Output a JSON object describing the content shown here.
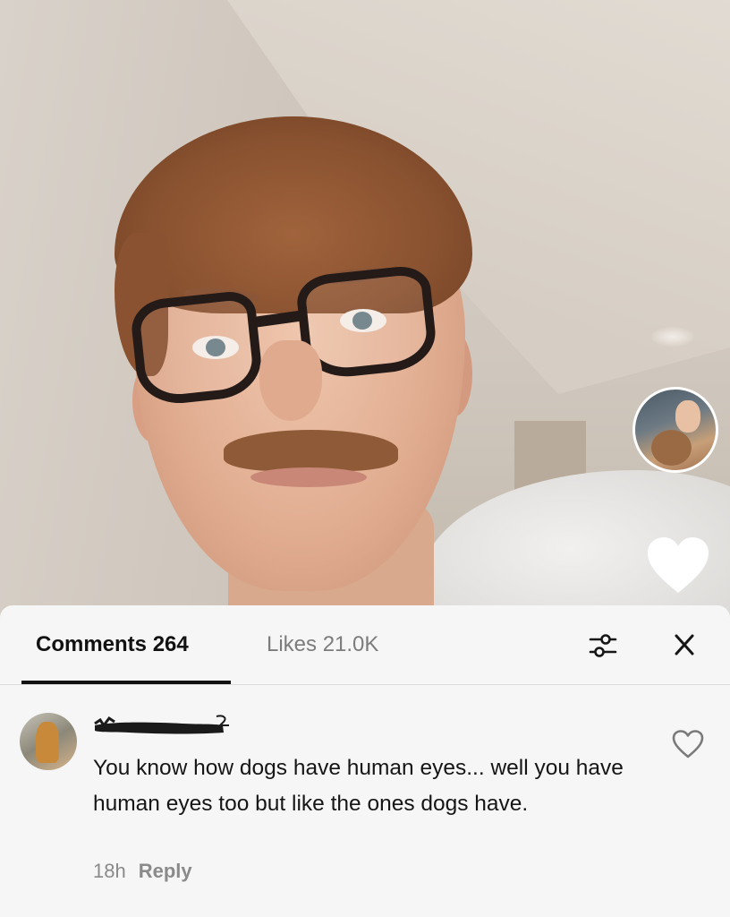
{
  "sheet": {
    "tabs": {
      "comments_label": "Comments 264",
      "likes_label": "Likes 21.0K"
    },
    "icons": {
      "filter": "sliders-icon",
      "close": "close-icon"
    }
  },
  "comment": {
    "username": "",
    "text": "You know how dogs have human eyes... well you have human eyes too but like the ones dogs have.",
    "time": "18h",
    "reply_label": "Reply"
  },
  "colors": {
    "sheet_bg": "#f6f6f6",
    "tab_active": "#121212",
    "tab_inactive": "#7c7c7c",
    "meta": "#8a8a8a"
  }
}
